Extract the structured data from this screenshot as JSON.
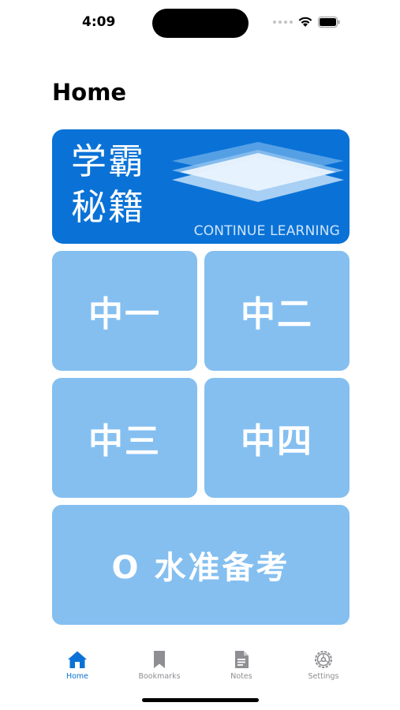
{
  "status_bar": {
    "time": "4:09"
  },
  "header": {
    "title": "Home"
  },
  "banner": {
    "title_line1": "学霸",
    "title_line2": "秘籍",
    "cta": "CONTINUE LEARNING",
    "icon": "layers-icon",
    "color": "#0a72d6"
  },
  "grades": {
    "tile_color": "#84bff0",
    "items": [
      {
        "label": "中一"
      },
      {
        "label": "中二"
      },
      {
        "label": "中三"
      },
      {
        "label": "中四"
      }
    ],
    "exam_prep": "O 水准备考"
  },
  "tab_bar": {
    "accent": "#0a72d6",
    "inactive_color": "#8e8e93",
    "items": [
      {
        "label": "Home",
        "icon": "home-icon",
        "active": true
      },
      {
        "label": "Bookmarks",
        "icon": "bookmark-icon",
        "active": false
      },
      {
        "label": "Notes",
        "icon": "document-icon",
        "active": false
      },
      {
        "label": "Settings",
        "icon": "gear-icon",
        "active": false
      }
    ]
  }
}
